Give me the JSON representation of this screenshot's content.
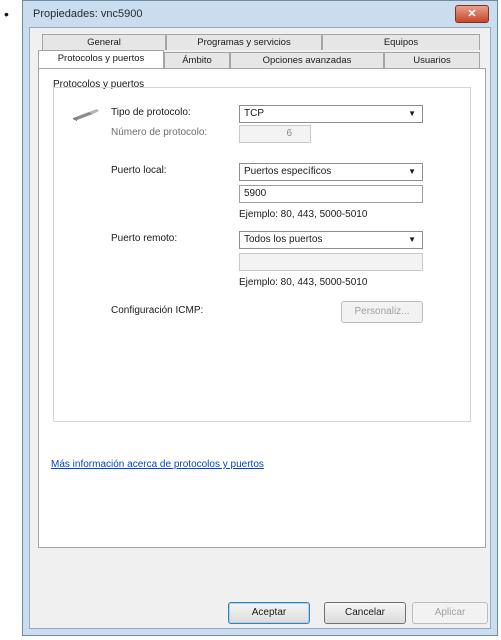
{
  "window": {
    "title": "Propiedades: vnc5900",
    "close_glyph": "✕"
  },
  "bullet": "•",
  "tabs_row1": [
    "General",
    "Programas y servicios",
    "Equipos"
  ],
  "tabs_row2": [
    "Protocolos y puertos",
    "Ámbito",
    "Opciones avanzadas",
    "Usuarios"
  ],
  "active_tab": "Protocolos y puertos",
  "group": {
    "label": "Protocolos y puertos",
    "icon": "network-cable-icon",
    "protocol_type_label": "Tipo de protocolo:",
    "protocol_type_value": "TCP",
    "protocol_number_label": "Número de protocolo:",
    "protocol_number_value": "6",
    "local_port_label": "Puerto local:",
    "local_port_select": "Puertos específicos",
    "local_port_value": "5900",
    "local_port_example": "Ejemplo: 80, 443, 5000-5010",
    "remote_port_label": "Puerto remoto:",
    "remote_port_select": "Todos los puertos",
    "remote_port_value": "",
    "remote_port_example": "Ejemplo: 80, 443, 5000-5010",
    "icmp_label": "Configuración ICMP:",
    "icmp_button": "Personaliz..."
  },
  "info_link": "Más información acerca de protocolos y puertos",
  "footer": {
    "ok": "Aceptar",
    "cancel": "Cancelar",
    "apply": "Aplicar"
  }
}
